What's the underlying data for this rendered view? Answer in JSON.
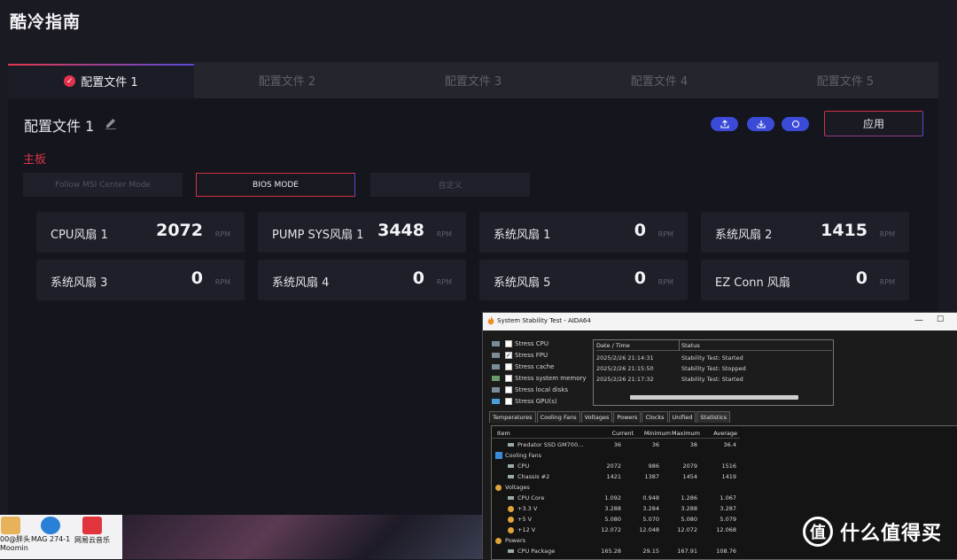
{
  "app": {
    "title": "酷冷指南"
  },
  "tabs": [
    {
      "label": "配置文件 1",
      "active": true
    },
    {
      "label": "配置文件 2",
      "active": false
    },
    {
      "label": "配置文件 3",
      "active": false
    },
    {
      "label": "配置文件 4",
      "active": false
    },
    {
      "label": "配置文件 5",
      "active": false
    }
  ],
  "profile": {
    "name": "配置文件 1",
    "apply_label": "应用",
    "icons": [
      "upload-icon",
      "download-icon",
      "reset-icon"
    ]
  },
  "section": {
    "label": "主板"
  },
  "modes": [
    {
      "label": "Follow MSI Center Mode",
      "active": false
    },
    {
      "label": "BIOS MODE",
      "active": true
    },
    {
      "label": "自定义",
      "active": false
    }
  ],
  "fans": [
    {
      "name": "CPU风扇 1",
      "value": "2072",
      "unit": "RPM"
    },
    {
      "name": "PUMP SYS风扇 1",
      "value": "3448",
      "unit": "RPM"
    },
    {
      "name": "系统风扇 1",
      "value": "0",
      "unit": "RPM"
    },
    {
      "name": "系统风扇 2",
      "value": "1415",
      "unit": "RPM"
    },
    {
      "name": "系统风扇 3",
      "value": "0",
      "unit": "RPM"
    },
    {
      "name": "系统风扇 4",
      "value": "0",
      "unit": "RPM"
    },
    {
      "name": "系统风扇 5",
      "value": "0",
      "unit": "RPM"
    },
    {
      "name": "EZ Conn 风扇",
      "value": "0",
      "unit": "RPM"
    }
  ],
  "desktop": {
    "icons": [
      {
        "label": "00@胖头\nMoomin",
        "color": "#e6b35a"
      },
      {
        "label": "MAG 274-1",
        "color": "#2a7fd6"
      },
      {
        "label": "网易云音乐",
        "color": "#e0353d"
      }
    ]
  },
  "watermark": {
    "glyph": "值",
    "text": "什么值得买"
  },
  "aida": {
    "title": "System Stability Test - AIDA64",
    "stress": [
      {
        "label": "Stress CPU",
        "checked": false
      },
      {
        "label": "Stress FPU",
        "checked": true
      },
      {
        "label": "Stress cache",
        "checked": false
      },
      {
        "label": "Stress system memory",
        "checked": false
      },
      {
        "label": "Stress local disks",
        "checked": false
      },
      {
        "label": "Stress GPU(s)",
        "checked": false
      }
    ],
    "log_headers": [
      "Date / Time",
      "Status"
    ],
    "log": [
      {
        "time": "2025/2/26 21:14:31",
        "status": "Stability Test: Started"
      },
      {
        "time": "2025/2/26 21:15:50",
        "status": "Stability Test: Stopped"
      },
      {
        "time": "2025/2/26 21:17:32",
        "status": "Stability Test: Started"
      }
    ],
    "tabs": [
      "Temperatures",
      "Cooling Fans",
      "Voltages",
      "Powers",
      "Clocks",
      "Unified",
      "Statistics"
    ],
    "stats_headers": [
      "Item",
      "Current",
      "Minimum",
      "Maximum",
      "Average"
    ],
    "stats": [
      {
        "type": "item",
        "name": "Predator SSD GM700...",
        "cur": "36",
        "min": "36",
        "max": "38",
        "avg": "36.4"
      },
      {
        "type": "group",
        "name": "Cooling Fans"
      },
      {
        "type": "item",
        "name": "CPU",
        "cur": "2072",
        "min": "986",
        "max": "2079",
        "avg": "1516"
      },
      {
        "type": "item",
        "name": "Chassis #2",
        "cur": "1421",
        "min": "1387",
        "max": "1454",
        "avg": "1419"
      },
      {
        "type": "group",
        "name": "Voltages"
      },
      {
        "type": "item",
        "name": "CPU Core",
        "cur": "1.092",
        "min": "0.948",
        "max": "1.286",
        "avg": "1.067"
      },
      {
        "type": "item",
        "name": "+3.3 V",
        "cur": "3.288",
        "min": "3.284",
        "max": "3.288",
        "avg": "3.287"
      },
      {
        "type": "item",
        "name": "+5 V",
        "cur": "5.080",
        "min": "5.070",
        "max": "5.080",
        "avg": "5.079"
      },
      {
        "type": "item",
        "name": "+12 V",
        "cur": "12.072",
        "min": "12.048",
        "max": "12.072",
        "avg": "12.068"
      },
      {
        "type": "group",
        "name": "Powers"
      },
      {
        "type": "item",
        "name": "CPU Package",
        "cur": "165.28",
        "min": "29.15",
        "max": "167.91",
        "avg": "108.76"
      }
    ]
  }
}
